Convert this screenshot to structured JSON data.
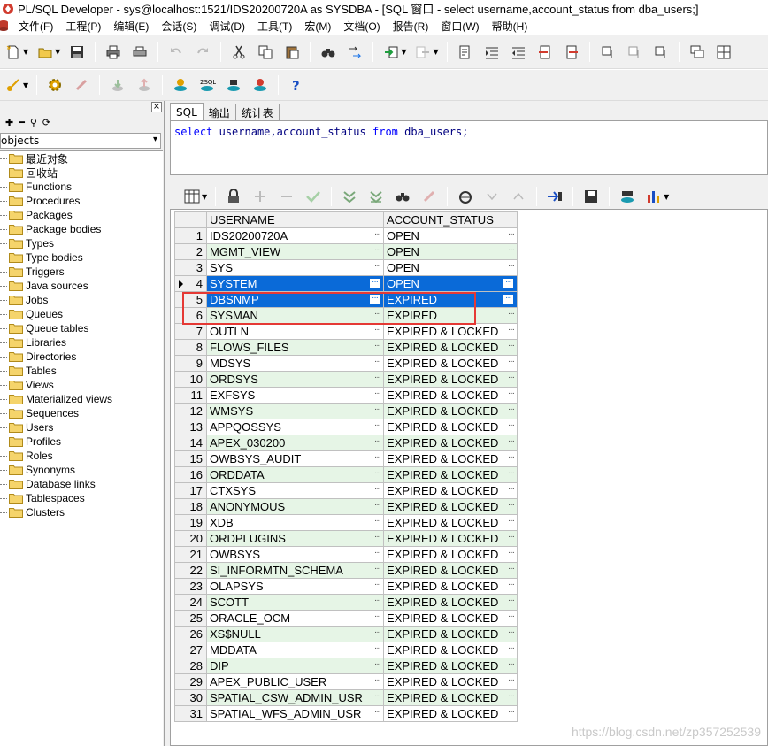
{
  "window": {
    "title": "PL/SQL Developer - sys@localhost:1521/IDS20200720A as SYSDBA - [SQL 窗口 - select username,account_status from dba_users;]"
  },
  "menu": [
    "文件(F)",
    "工程(P)",
    "编辑(E)",
    "会话(S)",
    "调试(D)",
    "工具(T)",
    "宏(M)",
    "文档(O)",
    "报告(R)",
    "窗口(W)",
    "帮助(H)"
  ],
  "object_browser": {
    "filter": "objects",
    "items": [
      "最近对象",
      "回收站",
      "Functions",
      "Procedures",
      "Packages",
      "Package bodies",
      "Types",
      "Type bodies",
      "Triggers",
      "Java sources",
      "Jobs",
      "Queues",
      "Queue tables",
      "Libraries",
      "Directories",
      "Tables",
      "Views",
      "Materialized views",
      "Sequences",
      "Users",
      "Profiles",
      "Roles",
      "Synonyms",
      "Database links",
      "Tablespaces",
      "Clusters"
    ]
  },
  "editor": {
    "tabs": [
      "SQL",
      "输出",
      "统计表"
    ],
    "sql": {
      "kw_select": "select",
      "cols": "username,account_status",
      "kw_from": "from",
      "table": "dba_users;"
    }
  },
  "grid": {
    "columns": [
      "USERNAME",
      "ACCOUNT_STATUS"
    ],
    "rows": [
      {
        "n": "1",
        "username": "IDS20200720A",
        "status": "OPEN"
      },
      {
        "n": "2",
        "username": "MGMT_VIEW",
        "status": "OPEN"
      },
      {
        "n": "3",
        "username": "SYS",
        "status": "OPEN"
      },
      {
        "n": "4",
        "username": "SYSTEM",
        "status": "OPEN"
      },
      {
        "n": "5",
        "username": "DBSNMP",
        "status": "EXPIRED"
      },
      {
        "n": "6",
        "username": "SYSMAN",
        "status": "EXPIRED"
      },
      {
        "n": "7",
        "username": "OUTLN",
        "status": "EXPIRED & LOCKED"
      },
      {
        "n": "8",
        "username": "FLOWS_FILES",
        "status": "EXPIRED & LOCKED"
      },
      {
        "n": "9",
        "username": "MDSYS",
        "status": "EXPIRED & LOCKED"
      },
      {
        "n": "10",
        "username": "ORDSYS",
        "status": "EXPIRED & LOCKED"
      },
      {
        "n": "11",
        "username": "EXFSYS",
        "status": "EXPIRED & LOCKED"
      },
      {
        "n": "12",
        "username": "WMSYS",
        "status": "EXPIRED & LOCKED"
      },
      {
        "n": "13",
        "username": "APPQOSSYS",
        "status": "EXPIRED & LOCKED"
      },
      {
        "n": "14",
        "username": "APEX_030200",
        "status": "EXPIRED & LOCKED"
      },
      {
        "n": "15",
        "username": "OWBSYS_AUDIT",
        "status": "EXPIRED & LOCKED"
      },
      {
        "n": "16",
        "username": "ORDDATA",
        "status": "EXPIRED & LOCKED"
      },
      {
        "n": "17",
        "username": "CTXSYS",
        "status": "EXPIRED & LOCKED"
      },
      {
        "n": "18",
        "username": "ANONYMOUS",
        "status": "EXPIRED & LOCKED"
      },
      {
        "n": "19",
        "username": "XDB",
        "status": "EXPIRED & LOCKED"
      },
      {
        "n": "20",
        "username": "ORDPLUGINS",
        "status": "EXPIRED & LOCKED"
      },
      {
        "n": "21",
        "username": "OWBSYS",
        "status": "EXPIRED & LOCKED"
      },
      {
        "n": "22",
        "username": "SI_INFORMTN_SCHEMA",
        "status": "EXPIRED & LOCKED"
      },
      {
        "n": "23",
        "username": "OLAPSYS",
        "status": "EXPIRED & LOCKED"
      },
      {
        "n": "24",
        "username": "SCOTT",
        "status": "EXPIRED & LOCKED"
      },
      {
        "n": "25",
        "username": "ORACLE_OCM",
        "status": "EXPIRED & LOCKED"
      },
      {
        "n": "26",
        "username": "XS$NULL",
        "status": "EXPIRED & LOCKED"
      },
      {
        "n": "27",
        "username": "MDDATA",
        "status": "EXPIRED & LOCKED"
      },
      {
        "n": "28",
        "username": "DIP",
        "status": "EXPIRED & LOCKED"
      },
      {
        "n": "29",
        "username": "APEX_PUBLIC_USER",
        "status": "EXPIRED & LOCKED"
      },
      {
        "n": "30",
        "username": "SPATIAL_CSW_ADMIN_USR",
        "status": "EXPIRED & LOCKED"
      },
      {
        "n": "31",
        "username": "SPATIAL_WFS_ADMIN_USR",
        "status": "EXPIRED & LOCKED"
      }
    ],
    "selected_rows": [
      "4",
      "5"
    ],
    "current_row": "4"
  },
  "watermark": "https://blog.csdn.net/zp357252539",
  "colors": {
    "selection": "#0a6ad8",
    "alt_row": "#e6f5e6",
    "highlight_box": "#e53935"
  }
}
